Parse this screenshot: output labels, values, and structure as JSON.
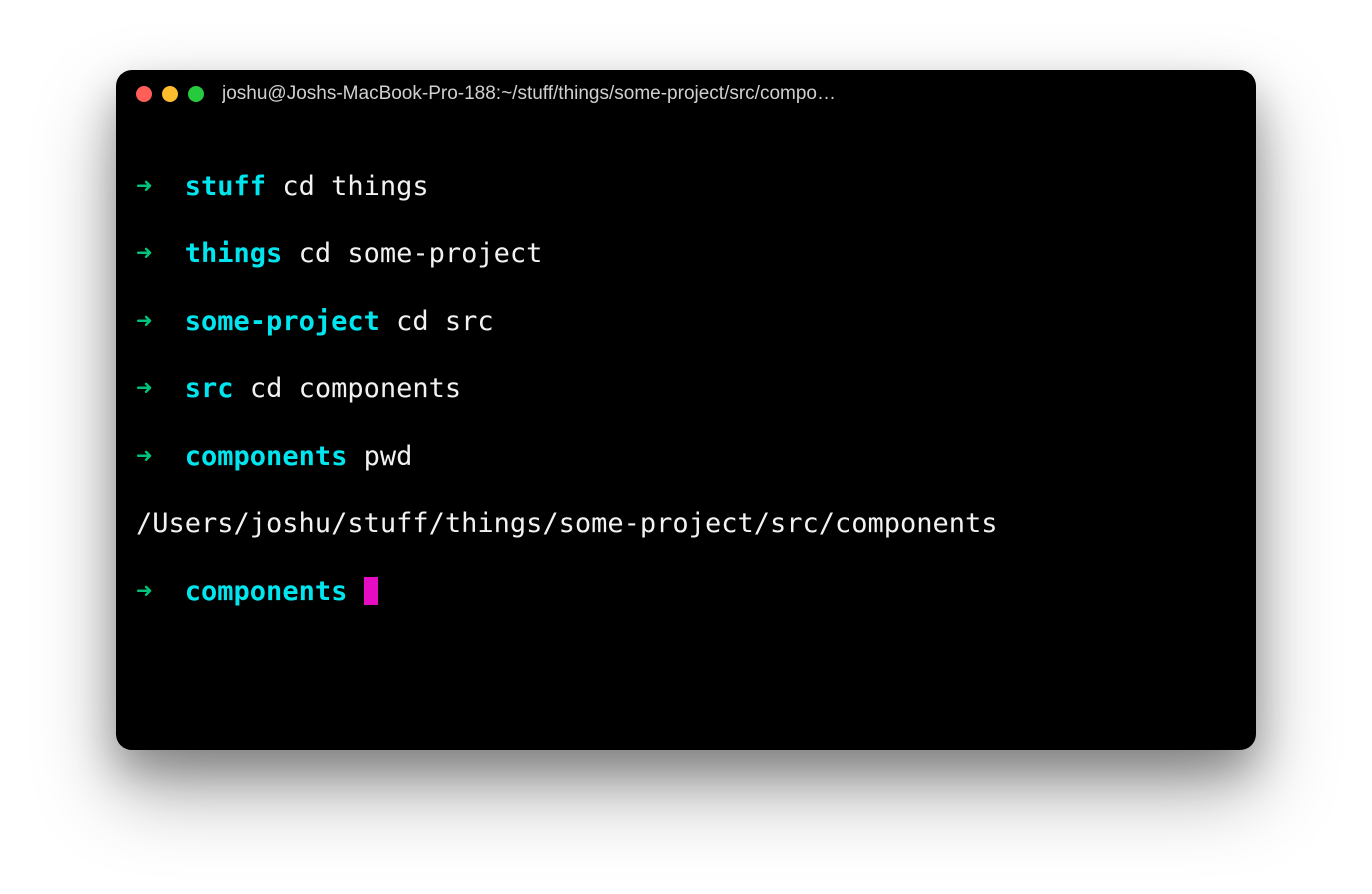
{
  "window": {
    "title": "joshu@Joshs-MacBook-Pro-188:~/stuff/things/some-project/src/compo…"
  },
  "prompt": {
    "arrow": "➜"
  },
  "lines": {
    "l0": {
      "dir": "stuff",
      "cmd": "cd things"
    },
    "l1": {
      "dir": "things",
      "cmd": "cd some-project"
    },
    "l2": {
      "dir": "some-project",
      "cmd": "cd src"
    },
    "l3": {
      "dir": "src",
      "cmd": "cd components"
    },
    "l4": {
      "dir": "components",
      "cmd": "pwd"
    },
    "out0": "/Users/joshu/stuff/things/some-project/src/components",
    "l5": {
      "dir": "components"
    }
  }
}
